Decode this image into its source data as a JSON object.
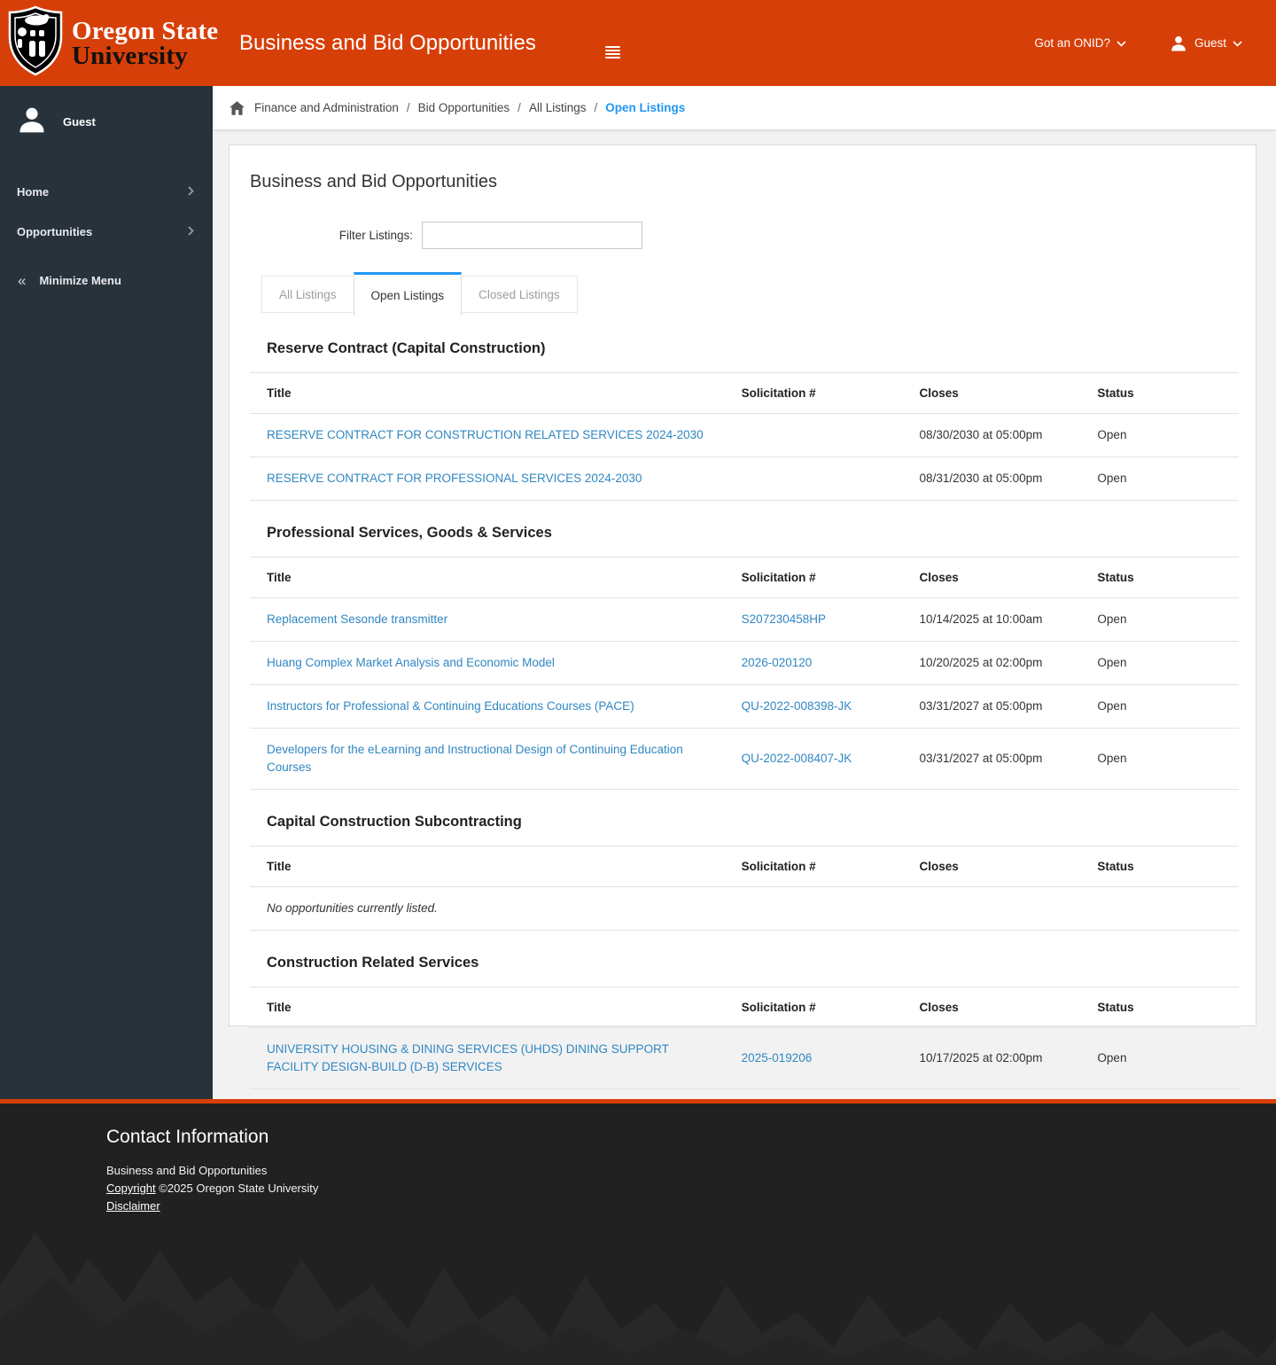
{
  "header": {
    "logo_line1": "Oregon State",
    "logo_line2": "University",
    "app_title": "Business and Bid Opportunities",
    "onid_label": "Got an ONID?",
    "user_label": "Guest"
  },
  "breadcrumb": {
    "items": [
      "Finance and Administration",
      "Bid Opportunities",
      "All Listings"
    ],
    "current": "Open Listings"
  },
  "sidebar": {
    "user_label": "Guest",
    "items": [
      {
        "label": "Home"
      },
      {
        "label": "Opportunities"
      }
    ],
    "minimize_label": "Minimize Menu"
  },
  "main": {
    "page_title": "Business and Bid Opportunities",
    "filter_label": "Filter Listings:",
    "filter_value": "",
    "tabs": [
      {
        "label": "All Listings",
        "active": false
      },
      {
        "label": "Open Listings",
        "active": true
      },
      {
        "label": "Closed Listings",
        "active": false
      }
    ],
    "columns": [
      "Title",
      "Solicitation #",
      "Closes",
      "Status"
    ],
    "empty_text": "No opportunities currently listed.",
    "sections": [
      {
        "heading": "Reserve Contract (Capital Construction)",
        "rows": [
          {
            "title": "RESERVE CONTRACT FOR CONSTRUCTION RELATED SERVICES 2024-2030",
            "solicitation": "",
            "closes": "08/30/2030 at 05:00pm",
            "status": "Open"
          },
          {
            "title": "RESERVE CONTRACT FOR PROFESSIONAL SERVICES 2024-2030",
            "solicitation": "",
            "closes": "08/31/2030 at 05:00pm",
            "status": "Open"
          }
        ]
      },
      {
        "heading": "Professional Services, Goods & Services",
        "rows": [
          {
            "title": "Replacement Sesonde transmitter",
            "solicitation": "S207230458HP",
            "closes": "10/14/2025 at 10:00am",
            "status": "Open"
          },
          {
            "title": "Huang Complex Market Analysis and Economic Model",
            "solicitation": "2026-020120",
            "closes": "10/20/2025 at 02:00pm",
            "status": "Open"
          },
          {
            "title": "Instructors for Professional & Continuing Educations Courses (PACE)",
            "solicitation": "QU-2022-008398-JK",
            "closes": "03/31/2027 at 05:00pm",
            "status": "Open"
          },
          {
            "title": "Developers for the eLearning and Instructional Design of Continuing Education Courses",
            "solicitation": "QU-2022-008407-JK",
            "closes": "03/31/2027 at 05:00pm",
            "status": "Open"
          }
        ]
      },
      {
        "heading": "Capital Construction Subcontracting",
        "rows": []
      },
      {
        "heading": "Construction Related Services",
        "rows": [
          {
            "title": "UNIVERSITY HOUSING & DINING SERVICES (UHDS) DINING SUPPORT FACILITY DESIGN-BUILD (D-B) SERVICES",
            "solicitation": "2025-019206",
            "closes": "10/17/2025 at 02:00pm",
            "status": "Open"
          }
        ]
      }
    ]
  },
  "footer": {
    "heading": "Contact Information",
    "line1": "Business and Bid Opportunities",
    "copyright_link": "Copyright",
    "copyright_rest": "©2025 Oregon State University",
    "disclaimer_link": "Disclaimer"
  },
  "colors": {
    "osu_orange": "#D73F09",
    "sidebar_bg": "#28323B",
    "link_blue": "#3087C2",
    "breadcrumb_active_blue": "#2196F3",
    "tab_active_border": "#2196F3",
    "footer_bg": "#212121",
    "page_bg": "#F2F2F2"
  },
  "icons": {
    "menu": "hamburger-icon",
    "user": "person-icon",
    "home": "home-icon",
    "chevron_down": "chevron-down-icon",
    "chevron_right": "chevron-right-icon",
    "minimize": "double-chevron-left-icon",
    "logo": "osu-crest-logo"
  }
}
